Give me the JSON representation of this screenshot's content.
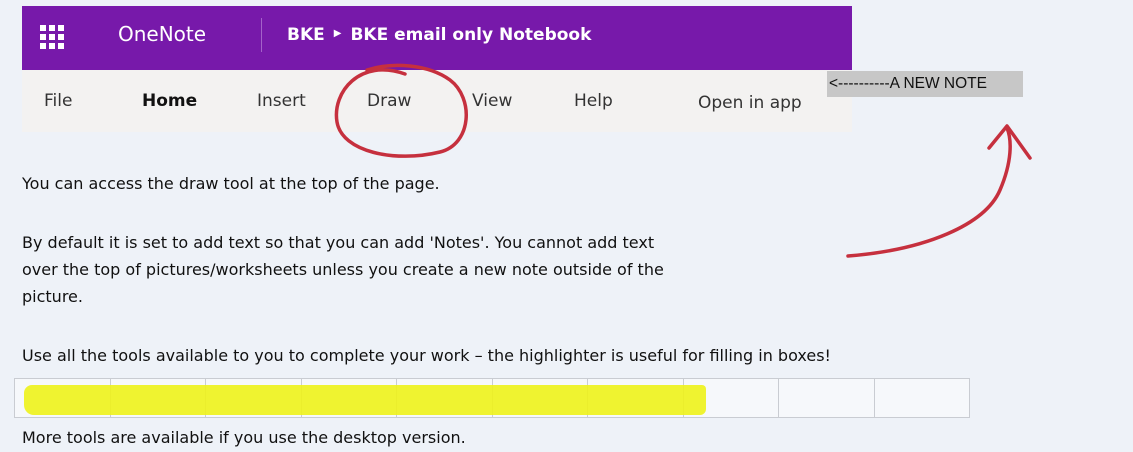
{
  "header": {
    "app_name": "OneNote",
    "breadcrumb": {
      "parent": "BKE",
      "separator_icon": "chevron-right-icon",
      "notebook": "BKE email only Notebook"
    }
  },
  "ribbon": {
    "tabs": [
      {
        "label": "File"
      },
      {
        "label": "Home",
        "active": true
      },
      {
        "label": "Insert"
      },
      {
        "label": "Draw"
      },
      {
        "label": "View"
      },
      {
        "label": "Help"
      }
    ],
    "open_in_app": "Open in app"
  },
  "annotation": {
    "label": "<----------A NEW NOTE"
  },
  "content": {
    "para1": "You can access the draw tool at the top of the page.",
    "para2_line1": "By default it is set to add text so that you can add 'Notes'. You cannot add text",
    "para2_line2": "over the top of pictures/worksheets unless you create a new note outside of the",
    "para2_line3": "picture.",
    "para3": "Use all the tools available to you to complete your work – the highlighter is useful for filling in boxes!",
    "para4": "More tools are available if you use the desktop version."
  },
  "colors": {
    "accent": "#7719aa",
    "highlight": "#eef21a",
    "ink": "#c6303e"
  }
}
